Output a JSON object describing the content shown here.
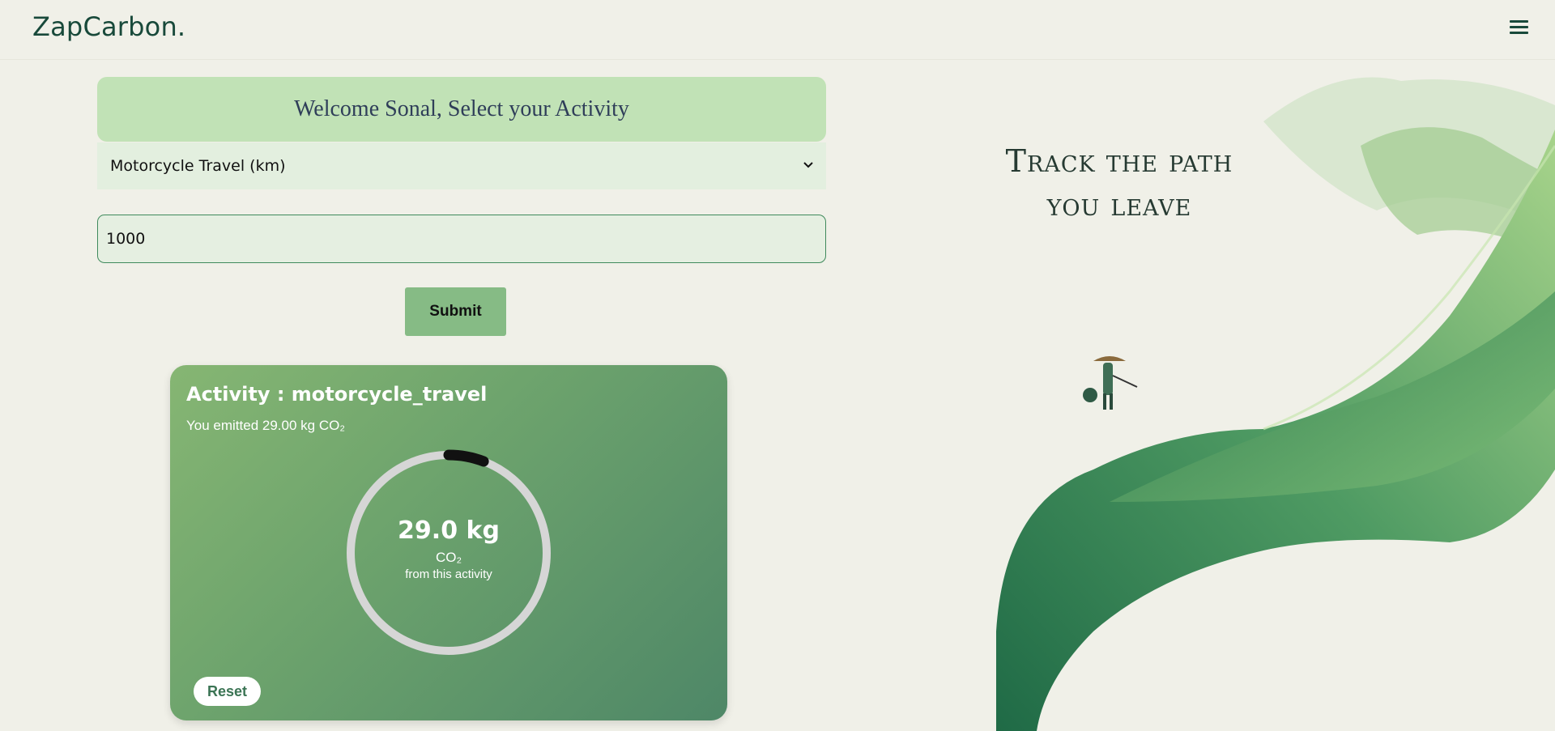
{
  "navbar": {
    "brand": "ZapCarbon.",
    "menu_icon": "hamburger-icon"
  },
  "form": {
    "welcome": "Welcome Sonal, Select your Activity",
    "activity_selected": "Motorcycle Travel (km)",
    "quantity_value": "1000",
    "submit_label": "Submit"
  },
  "result": {
    "title": "Activity : motorcycle_travel",
    "subtitle": "You emitted 29.00 kg CO₂",
    "gauge_value": "29.0 kg",
    "gauge_unit": "CO₂",
    "gauge_caption": "from this activity",
    "gauge_fraction": 0.058,
    "reset_label": "Reset"
  },
  "hero": {
    "headline": "Track the path you leave"
  },
  "colors": {
    "brand": "#18493a",
    "banner": "#c1e2b6",
    "submit": "#86bb85",
    "card_start": "#86b673",
    "card_end": "#4e8767",
    "gauge_track": "#d6d6d6",
    "gauge_fill": "#111111"
  }
}
